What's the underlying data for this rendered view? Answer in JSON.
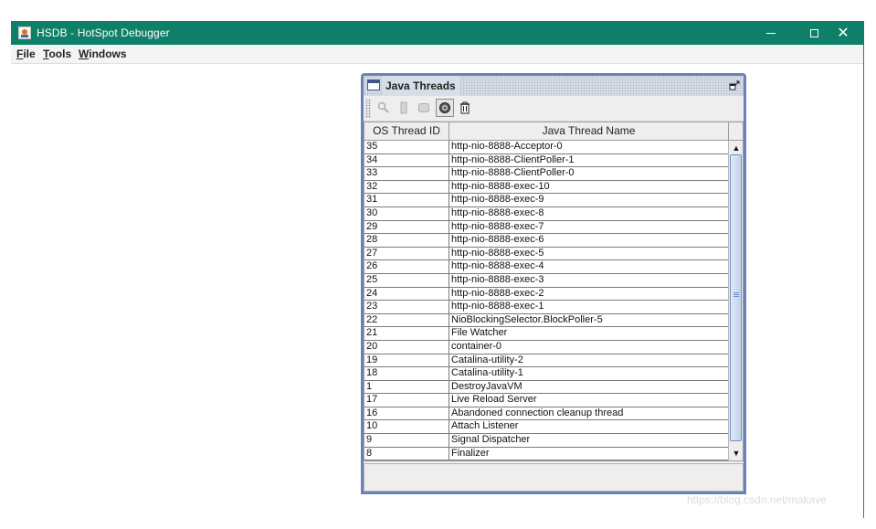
{
  "window": {
    "title": "HSDB - HotSpot Debugger",
    "controls": {
      "minimize": "–",
      "maximize": "□",
      "close": "✕"
    },
    "accent_color": "#0e7f68"
  },
  "menubar": {
    "items": [
      {
        "label": "File",
        "mnemonic": "F",
        "rest": "ile"
      },
      {
        "label": "Tools",
        "mnemonic": "T",
        "rest": "ools"
      },
      {
        "label": "Windows",
        "mnemonic": "W",
        "rest": "indows"
      }
    ]
  },
  "java_threads": {
    "title": "Java Threads",
    "toolbar": [
      {
        "name": "inspect-thread",
        "icon": "magnifier-icon",
        "enabled": false
      },
      {
        "name": "stack-memory",
        "icon": "memory-icon",
        "enabled": false
      },
      {
        "name": "thread-info",
        "icon": "info-icon",
        "enabled": false
      },
      {
        "name": "find-crashes",
        "icon": "crash-icon",
        "enabled": true
      },
      {
        "name": "delete",
        "icon": "trash-icon",
        "enabled": true
      }
    ],
    "columns": [
      "OS Thread ID",
      "Java Thread Name"
    ],
    "rows": [
      [
        "35",
        "http-nio-8888-Acceptor-0"
      ],
      [
        "34",
        "http-nio-8888-ClientPoller-1"
      ],
      [
        "33",
        "http-nio-8888-ClientPoller-0"
      ],
      [
        "32",
        "http-nio-8888-exec-10"
      ],
      [
        "31",
        "http-nio-8888-exec-9"
      ],
      [
        "30",
        "http-nio-8888-exec-8"
      ],
      [
        "29",
        "http-nio-8888-exec-7"
      ],
      [
        "28",
        "http-nio-8888-exec-6"
      ],
      [
        "27",
        "http-nio-8888-exec-5"
      ],
      [
        "26",
        "http-nio-8888-exec-4"
      ],
      [
        "25",
        "http-nio-8888-exec-3"
      ],
      [
        "24",
        "http-nio-8888-exec-2"
      ],
      [
        "23",
        "http-nio-8888-exec-1"
      ],
      [
        "22",
        "NioBlockingSelector.BlockPoller-5"
      ],
      [
        "21",
        "File Watcher"
      ],
      [
        "20",
        "container-0"
      ],
      [
        "19",
        "Catalina-utility-2"
      ],
      [
        "18",
        "Catalina-utility-1"
      ],
      [
        "1",
        "DestroyJavaVM"
      ],
      [
        "17",
        "Live Reload Server"
      ],
      [
        "16",
        "Abandoned connection cleanup thread"
      ],
      [
        "10",
        "Attach Listener"
      ],
      [
        "9",
        "Signal Dispatcher"
      ],
      [
        "8",
        "Finalizer"
      ]
    ],
    "frame_color": "#6882b8"
  },
  "watermark": "https://blog.csdn.net/makave"
}
